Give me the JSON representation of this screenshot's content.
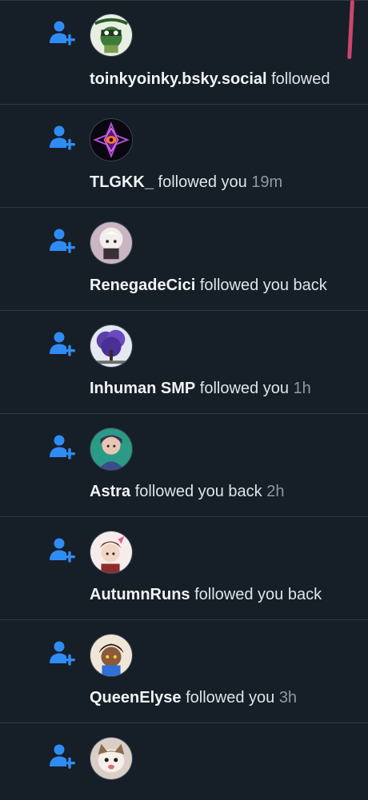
{
  "colors": {
    "background": "#161e27",
    "separator": "#2e3945",
    "icon_blue": "#2f8cf5",
    "name_text": "#f1f3f5",
    "body_text": "#dfe4ea",
    "time_text": "#8d99a6",
    "scroll_indicator": "#c9476b"
  },
  "notifications": [
    {
      "icon": "person-plus-icon",
      "avatar": "avatar-toinkyoinky",
      "name": "toinkyoinky.bsky.social",
      "action": " followed",
      "time": ""
    },
    {
      "icon": "person-plus-icon",
      "avatar": "avatar-tlgkk",
      "name": "TLGKK_",
      "action": " followed you ",
      "time": "19m"
    },
    {
      "icon": "person-plus-icon",
      "avatar": "avatar-renegadecici",
      "name": "RenegadeCici",
      "action": " followed you back",
      "time": ""
    },
    {
      "icon": "person-plus-icon",
      "avatar": "avatar-inhuman-smp",
      "name": "Inhuman SMP",
      "action": " followed you ",
      "time": "1h"
    },
    {
      "icon": "person-plus-icon",
      "avatar": "avatar-astra",
      "name": "Astra",
      "action": " followed you back ",
      "time": "2h"
    },
    {
      "icon": "person-plus-icon",
      "avatar": "avatar-autumnruns",
      "name": "AutumnRuns",
      "action": " followed you back",
      "time": ""
    },
    {
      "icon": "person-plus-icon",
      "avatar": "avatar-queenelyse",
      "name": "QueenElyse",
      "action": " followed you ",
      "time": "3h"
    },
    {
      "icon": "person-plus-icon",
      "avatar": "avatar-cat",
      "name": "",
      "action": "",
      "time": ""
    }
  ]
}
